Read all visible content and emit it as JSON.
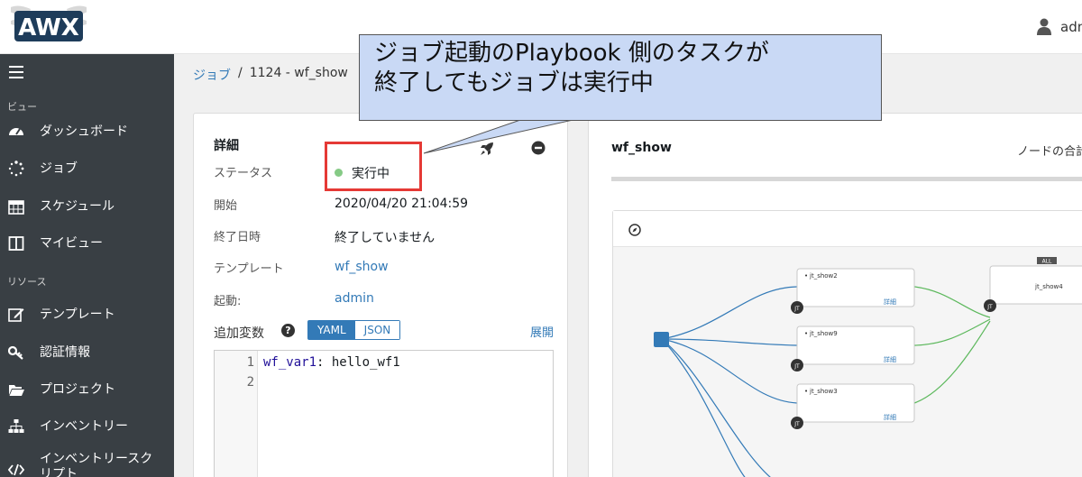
{
  "header": {
    "logo_text": "AWX",
    "user_name": "admin"
  },
  "sidebar": {
    "section_view": "ビュー",
    "section_resources": "リソース",
    "items": [
      {
        "label": "ダッシュボード",
        "icon": "dashboard-icon"
      },
      {
        "label": "ジョブ",
        "icon": "jobs-spinner-icon"
      },
      {
        "label": "スケジュール",
        "icon": "calendar-icon"
      },
      {
        "label": "マイビュー",
        "icon": "columns-icon"
      },
      {
        "label": "テンプレート",
        "icon": "edit-icon"
      },
      {
        "label": "認証情報",
        "icon": "key-icon"
      },
      {
        "label": "プロジェクト",
        "icon": "folder-icon"
      },
      {
        "label": "インベントリー",
        "icon": "sitemap-icon"
      },
      {
        "label": "インベントリースクリプト",
        "icon": "code-icon"
      }
    ]
  },
  "breadcrumb": {
    "parent": "ジョブ",
    "separator": "/",
    "current": "1124 - wf_show"
  },
  "details": {
    "title": "詳細",
    "status_label": "ステータス",
    "status_value": "実行中",
    "status_color": "#5cb85c",
    "started_label": "開始",
    "started_value": "2020/04/20 21:04:59",
    "finished_label": "終了日時",
    "finished_value": "終了していません",
    "template_label": "テンプレート",
    "template_value": "wf_show",
    "launched_by_label": "起動:",
    "launched_by_value": "admin",
    "extra_vars_label": "追加変数",
    "help": "?",
    "yaml_label": "YAML",
    "json_label": "JSON",
    "expand_label": "展開",
    "code": {
      "line_numbers": [
        "1",
        "2"
      ],
      "key": "wf_var1",
      "value": ": hello_wf1"
    }
  },
  "workflow": {
    "title": "wf_show",
    "legend_label": "ノードの合計",
    "badge_all": "ALL",
    "nodes": [
      {
        "name": "jt_show2",
        "details": "詳細",
        "type": "JT"
      },
      {
        "name": "jt_show9",
        "details": "詳細",
        "type": "JT"
      },
      {
        "name": "jt_show3",
        "details": "詳細",
        "type": "JT"
      },
      {
        "name": "jt_show4",
        "details": "",
        "type": "JT"
      }
    ]
  },
  "callout": {
    "line1": "ジョブ起動のPlaybook 側のタスクが",
    "line2": "終了してもジョブは実行中"
  },
  "colors": {
    "sidebar_bg": "#393f44",
    "link": "#337ab7",
    "highlight_border": "#e53935",
    "callout_bg": "#c9d9f5",
    "edge_success": "#5cb85c",
    "edge_always": "#337ab7"
  }
}
